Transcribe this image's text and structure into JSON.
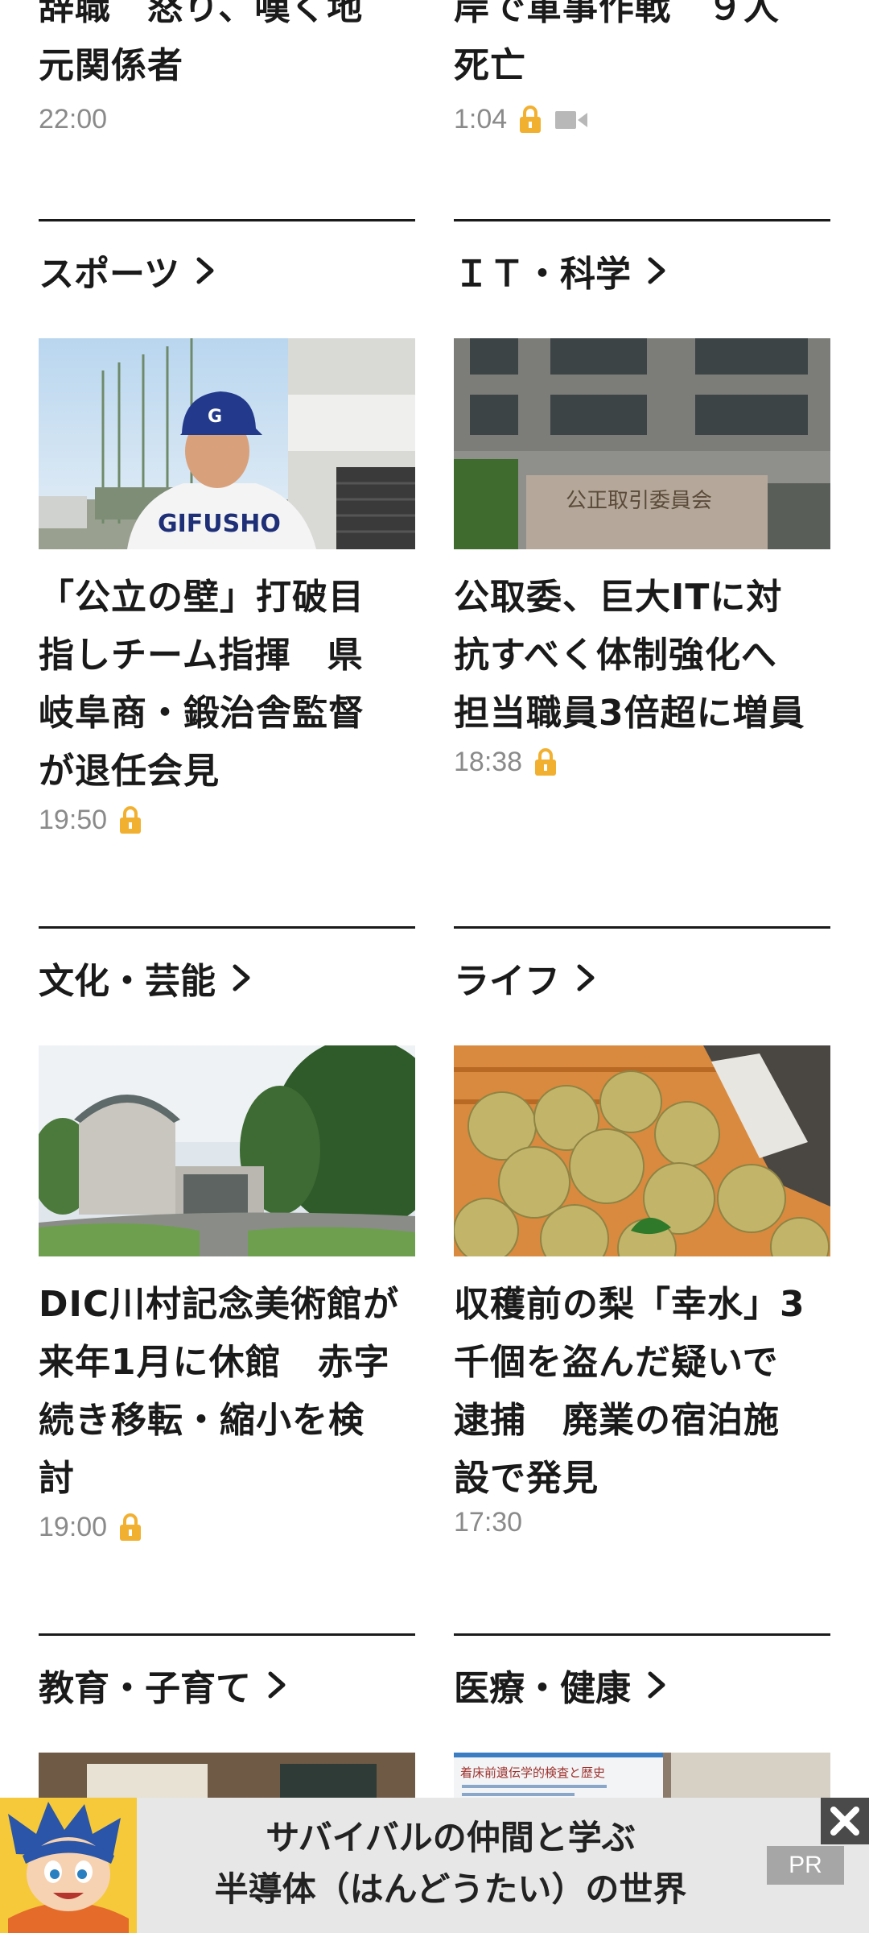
{
  "top": {
    "left": {
      "title_tail": "辞職　怒り、嘆く地\n元関係者",
      "time": "22:00"
    },
    "right": {
      "title_tail": "岸で軍事作戦　９人\n死亡",
      "time": "1:04"
    }
  },
  "sections": [
    {
      "left": {
        "header": "スポーツ",
        "title": "「公立の壁」打破目\n指しチーム指揮　県\n岐阜商・鍛治舎監督\nが退任会見",
        "time": "19:50",
        "cap_text": "GIFUSHO"
      },
      "right": {
        "header": "ＩＴ・科学",
        "title": "公取委、巨大ITに対\n抗すべく体制強化へ\n担当職員3倍超に増員",
        "time": "18:38",
        "sign_text": "公正取引委員会"
      }
    },
    {
      "left": {
        "header": "文化・芸能",
        "title": "DIC川村記念美術館が\n来年1月に休館　赤字\n続き移転・縮小を検\n討",
        "time": "19:00"
      },
      "right": {
        "header": "ライフ",
        "title": "収穫前の梨「幸水」3\n千個を盗んだ疑いで\n逮捕　廃業の宿泊施\n設で発見",
        "time": "17:30"
      }
    },
    {
      "left": {
        "header": "教育・子育て"
      },
      "right": {
        "header": "医療・健康",
        "slide_text": "着床前遺伝学的検査と歴史"
      }
    }
  ],
  "banner": {
    "line1": "サバイバルの仲間と学ぶ",
    "line2": "半導体（はんどうたい）の世界",
    "pr": "PR"
  },
  "colors": {
    "lock": "#f2b030",
    "video": "#b8b8b8",
    "rule": "#1a1a1a",
    "meta": "#8a8a8a"
  },
  "icons": {
    "lock": "lock-icon",
    "video": "video-camera-icon",
    "chevron": "chevron-right-icon",
    "close": "close-icon"
  }
}
